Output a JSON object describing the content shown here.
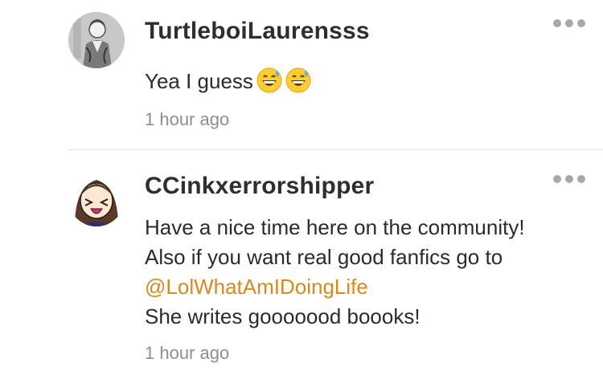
{
  "comments": [
    {
      "username": "TurtleboiLaurensss",
      "avatar": "avatar-photo-icon",
      "text_lines": [
        "Yea I guess"
      ],
      "emojis": [
        "grinning-sweat-face-icon",
        "grinning-sweat-face-icon"
      ],
      "timestamp": "1 hour ago",
      "menu": "more-options-icon"
    },
    {
      "username": "CCinkxerrorshipper",
      "avatar": "avatar-cartoon-icon",
      "text_lines": [
        "Have a nice time here on the community!",
        "Also if you want real good fanfics go to",
        "@LolWhatAmIDoingLife",
        "She writes gooooood boooks!"
      ],
      "mention": "@LolWhatAmIDoingLife",
      "timestamp": "1 hour ago",
      "menu": "more-options-icon"
    }
  ],
  "colors": {
    "mention": "#d88a1e",
    "username": "#2e2e2e",
    "timestamp": "#8e8e8e",
    "menu_dots": "#a8a8a8"
  }
}
